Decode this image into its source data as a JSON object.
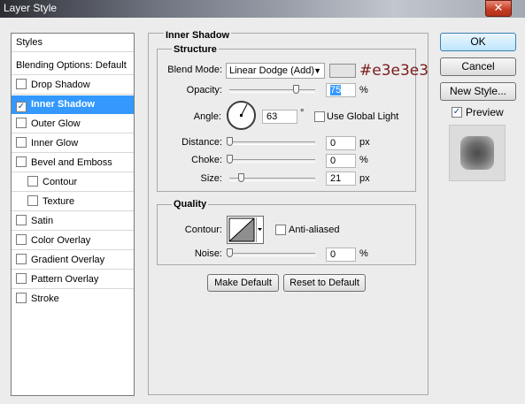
{
  "window": {
    "title": "Layer Style",
    "close_glyph": "✕"
  },
  "styles_list": {
    "header": "Styles",
    "blending": "Blending Options: Default",
    "items": [
      {
        "label": "Drop Shadow",
        "checked": false
      },
      {
        "label": "Inner Shadow",
        "checked": true
      },
      {
        "label": "Outer Glow",
        "checked": false
      },
      {
        "label": "Inner Glow",
        "checked": false
      },
      {
        "label": "Bevel and Emboss",
        "checked": false
      },
      {
        "label": "Contour",
        "checked": false
      },
      {
        "label": "Texture",
        "checked": false
      },
      {
        "label": "Satin",
        "checked": false
      },
      {
        "label": "Color Overlay",
        "checked": false
      },
      {
        "label": "Gradient Overlay",
        "checked": false
      },
      {
        "label": "Pattern Overlay",
        "checked": false
      },
      {
        "label": "Stroke",
        "checked": false
      }
    ]
  },
  "inner_shadow": {
    "title": "Inner Shadow",
    "structure": {
      "title": "Structure",
      "blend_mode_label": "Blend Mode:",
      "blend_mode_value": "Linear Dodge (Add)",
      "color_hex": "#e3e3e3",
      "opacity_label": "Opacity:",
      "opacity_value": "75",
      "opacity_unit": "%",
      "angle_label": "Angle:",
      "angle_value": "63",
      "angle_unit": "°",
      "use_global_light": "Use Global Light",
      "distance_label": "Distance:",
      "distance_value": "0",
      "distance_unit": "px",
      "choke_label": "Choke:",
      "choke_value": "0",
      "choke_unit": "%",
      "size_label": "Size:",
      "size_value": "21",
      "size_unit": "px"
    },
    "quality": {
      "title": "Quality",
      "contour_label": "Contour:",
      "anti_aliased": "Anti-aliased",
      "noise_label": "Noise:",
      "noise_value": "0",
      "noise_unit": "%"
    },
    "make_default": "Make Default",
    "reset_default": "Reset to Default"
  },
  "buttons": {
    "ok": "OK",
    "cancel": "Cancel",
    "new_style": "New Style...",
    "preview": "Preview"
  },
  "preview_checked": true
}
